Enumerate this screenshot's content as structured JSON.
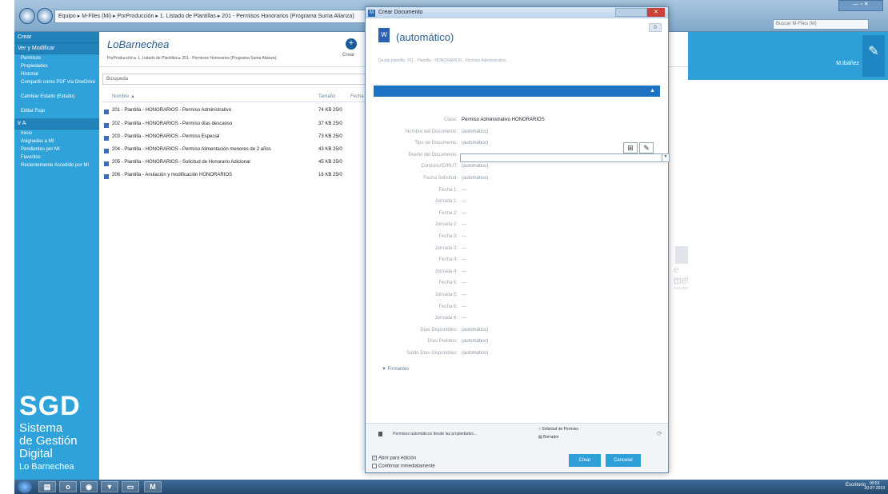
{
  "window": {
    "address": "Equipo ▸ M-Files (Mi) ▸ PorProducción ▸ 1. Listado de Plantillas ▸ 201 - Permisos Honorarios (Programa Suma Alianza)",
    "right_search_placeholder": "Buscar M-Files (M)",
    "controls": "— ▫ ✕"
  },
  "leftnav": {
    "header": "Crear",
    "header2": "Ver y Modificar",
    "items": [
      "Permisos",
      "Propiedades",
      "Historial",
      "Compartir como PDF vía OneDrive",
      "Cambiar Estado (Estado)",
      "Editar Flujo"
    ],
    "section": "Ir A",
    "items2": [
      "Inicio",
      "Asignadas a Mí",
      "Pendientes por Mí",
      "Favoritos",
      "Recientemente Accedido por Mí"
    ]
  },
  "brand": {
    "short": "SGD",
    "line1": "Sistema",
    "line2": "de Gestión",
    "line3": "Digital",
    "line4": "Lo Barnechea"
  },
  "listing": {
    "logo": "LoBarnechea",
    "breadcrumb": "PorProducción ▸ 1. Listado de Plantillas ▸ 201 - Permisos Honorarios (Programa Suma Alianza)",
    "create_label": "Crear",
    "search_placeholder": "Búsqueda",
    "col_name": "Nombre ▲",
    "col_size": "Tamaño",
    "col_date": "Fecha",
    "rows": [
      {
        "name": "201 - Plantilla - HONORARIOS - Permiso Administrativo",
        "size": "74 KB",
        "date": "25/0"
      },
      {
        "name": "202 - Plantilla - HONORARIOS - Permiso días descanso",
        "size": "37 KB",
        "date": "25/0"
      },
      {
        "name": "203 - Plantilla - HONORARIOS - Permiso Especial",
        "size": "73 KB",
        "date": "25/0"
      },
      {
        "name": "204 - Plantilla - HONORARIOS - Permiso Alimentación menores de 2 años",
        "size": "43 KB",
        "date": "25/0"
      },
      {
        "name": "205 - Plantilla - HONORARIOS - Solicitud de Honorario Adicional",
        "size": "45 KB",
        "date": "25/0"
      },
      {
        "name": "206 - Plantilla - Anulación y modificación HONORARIOS",
        "size": "16 KB",
        "date": "25/0"
      }
    ],
    "metadata_title": "e metadatos",
    "metadata_sub": "para ver sus metadatos"
  },
  "rightstrip": {
    "user": "M.Ibáñez"
  },
  "dialog": {
    "title": "Crear Documento",
    "app_icon": "M",
    "badge": "0",
    "doc_icon": "W",
    "doc_title": "(automático)",
    "doc_path": "Desde plantilla: 201 - Plantilla - HONORARIOS - Permiso Administrativo",
    "props": [
      {
        "label": "Clase:",
        "value": "Permiso Administrativo HONORARIOS",
        "dark": true
      },
      {
        "label": "Nombre del Documento:",
        "value": "(automático)",
        "dark": false
      },
      {
        "label": "Tipo de Documento:",
        "value": "(automático)",
        "dark": false
      },
      {
        "label": "Dueño del Documento:",
        "value": "",
        "dark": false
      },
      {
        "label": "Contrato/ID/RUT:",
        "value": "(automático)",
        "dark": false
      },
      {
        "label": "Fecha Solicitud:",
        "value": "(automático)",
        "dark": false
      },
      {
        "label": "Fecha 1:",
        "value": "---",
        "dark": false
      },
      {
        "label": "Jornada 1:",
        "value": "---",
        "dark": false
      },
      {
        "label": "Fecha 2:",
        "value": "---",
        "dark": false
      },
      {
        "label": "Jornada 2:",
        "value": "---",
        "dark": false
      },
      {
        "label": "Fecha 3:",
        "value": "---",
        "dark": false
      },
      {
        "label": "Jornada 3:",
        "value": "---",
        "dark": false
      },
      {
        "label": "Fecha 4:",
        "value": "---",
        "dark": false
      },
      {
        "label": "Jornada 4:",
        "value": "---",
        "dark": false
      },
      {
        "label": "Fecha 5:",
        "value": "---",
        "dark": false
      },
      {
        "label": "Jornada 5:",
        "value": "---",
        "dark": false
      },
      {
        "label": "Fecha 6:",
        "value": "---",
        "dark": false
      },
      {
        "label": "Jornada 6:",
        "value": "---",
        "dark": false
      },
      {
        "label": "Días Disponibles:",
        "value": "(automático)",
        "dark": false
      },
      {
        "label": "Días Pedidos:",
        "value": "(automático)",
        "dark": false
      },
      {
        "label": "Saldo Días Disponibles:",
        "value": "(automático)",
        "dark": false
      }
    ],
    "firmantes": "▼ Firmantes",
    "permissions_text": "Permisos automáticos desde las propiedades...",
    "workflow": "Solicitud de Permiso",
    "state": "Borrador",
    "open_for_edit": "Abrir para edición",
    "confirm_now": "Confirmar inmediatamente",
    "create_btn": "Crear",
    "cancel_btn": "Cancelar"
  },
  "taskbar": {
    "tray": "Escritorio",
    "time": "09:53",
    "date": "30-07-2019"
  }
}
